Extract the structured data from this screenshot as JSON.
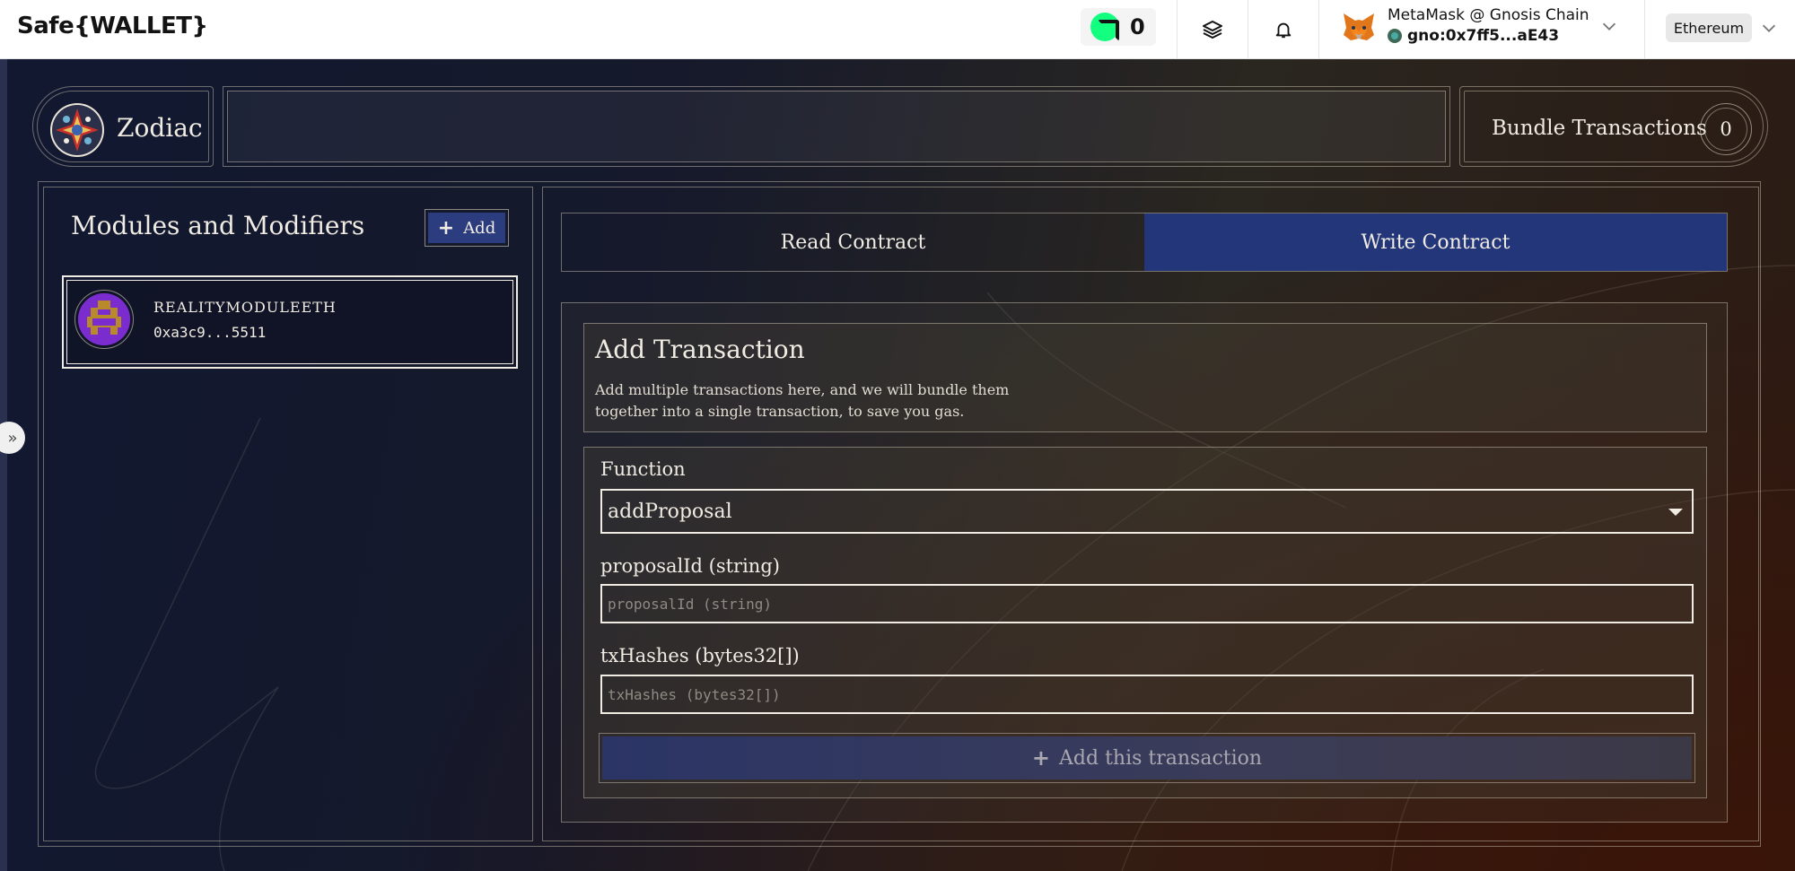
{
  "topbar": {
    "brand": "Safe{WALLET}",
    "counter": "0",
    "wallet_name": "MetaMask @ Gnosis Chain",
    "wallet_address": "gno:0x7ff5...aE43",
    "network": "Ethereum"
  },
  "header": {
    "app_title": "Zodiac",
    "bundle_label": "Bundle Transactions",
    "bundle_count": "0"
  },
  "modules": {
    "title": "Modules and Modifiers",
    "add_label": "Add",
    "items": [
      {
        "name": "REALITYMODULEETH",
        "address": "0xa3c9...5511"
      }
    ]
  },
  "tabs": [
    {
      "label": "Read Contract",
      "active": false
    },
    {
      "label": "Write Contract",
      "active": true
    }
  ],
  "transaction": {
    "title": "Add Transaction",
    "description": "Add multiple transactions here, and we will bundle them together into a single transaction, to save you gas.",
    "function_label": "Function",
    "function_value": "addProposal",
    "fields": [
      {
        "label": "proposalId (string)",
        "placeholder": "proposalId (string)"
      },
      {
        "label": "txHashes (bytes32[])",
        "placeholder": "txHashes (bytes32[])"
      }
    ],
    "submit_label": "Add this transaction"
  },
  "colors": {
    "accent_active_tab": "#24367a",
    "add_button": "#2b3d7e",
    "safe_green": "#12ff80"
  },
  "icons": [
    "safe-token-icon",
    "layers-icon",
    "bell-icon",
    "metamask-fox-icon",
    "gnosis-chain-icon",
    "chevron-down-icon",
    "plus-icon",
    "caret-down-icon",
    "double-chevron-right-icon"
  ]
}
